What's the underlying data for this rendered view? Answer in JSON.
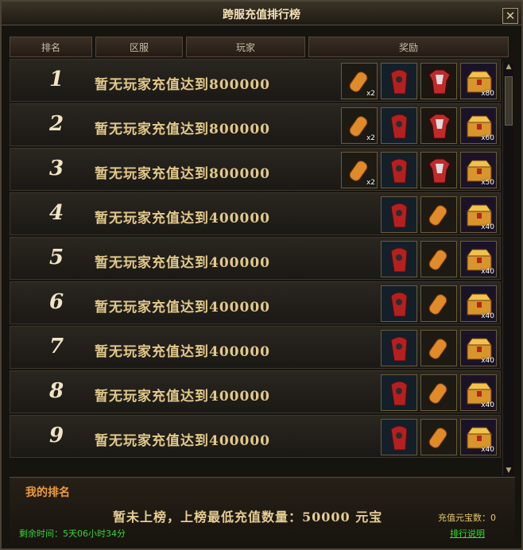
{
  "window": {
    "title": "跨服充值排行榜",
    "close_label": "✕"
  },
  "header": {
    "col_rank": "排名",
    "col_server": "区服",
    "col_player": "玩家",
    "col_reward": "奖励"
  },
  "rows": [
    {
      "rank": "1",
      "msg": "暂无玩家充值达到800000",
      "items": [
        {
          "icon": "orange-bullet-icon",
          "count": "x2",
          "q": "gold"
        },
        {
          "icon": "red-cloak-icon",
          "count": "",
          "q": "gold"
        },
        {
          "icon": "red-armor-icon",
          "count": "",
          "q": "gold"
        },
        {
          "icon": "treasure-chest-icon",
          "count": "x80",
          "q": "purple"
        }
      ]
    },
    {
      "rank": "2",
      "msg": "暂无玩家充值达到800000",
      "items": [
        {
          "icon": "orange-bullet-icon",
          "count": "x2",
          "q": "gold"
        },
        {
          "icon": "red-cloak-icon",
          "count": "",
          "q": "gold"
        },
        {
          "icon": "red-armor-icon",
          "count": "",
          "q": "gold"
        },
        {
          "icon": "treasure-chest-icon",
          "count": "x60",
          "q": "purple"
        }
      ]
    },
    {
      "rank": "3",
      "msg": "暂无玩家充值达到800000",
      "items": [
        {
          "icon": "orange-bullet-icon",
          "count": "x2",
          "q": "gold"
        },
        {
          "icon": "red-cloak-icon",
          "count": "",
          "q": "gold"
        },
        {
          "icon": "red-armor-icon",
          "count": "",
          "q": "gold"
        },
        {
          "icon": "treasure-chest-icon",
          "count": "x50",
          "q": "purple"
        }
      ]
    },
    {
      "rank": "4",
      "msg": "暂无玩家充值达到400000",
      "items": [
        {
          "icon": "red-cloak-icon",
          "count": "",
          "q": "gold"
        },
        {
          "icon": "orange-bullet-icon",
          "count": "",
          "q": "gold"
        },
        {
          "icon": "treasure-chest-icon",
          "count": "x40",
          "q": "purple"
        }
      ]
    },
    {
      "rank": "5",
      "msg": "暂无玩家充值达到400000",
      "items": [
        {
          "icon": "red-cloak-icon",
          "count": "",
          "q": "gold"
        },
        {
          "icon": "orange-bullet-icon",
          "count": "",
          "q": "gold"
        },
        {
          "icon": "treasure-chest-icon",
          "count": "x40",
          "q": "purple"
        }
      ]
    },
    {
      "rank": "6",
      "msg": "暂无玩家充值达到400000",
      "items": [
        {
          "icon": "red-cloak-icon",
          "count": "",
          "q": "gold"
        },
        {
          "icon": "orange-bullet-icon",
          "count": "",
          "q": "gold"
        },
        {
          "icon": "treasure-chest-icon",
          "count": "x40",
          "q": "purple"
        }
      ]
    },
    {
      "rank": "7",
      "msg": "暂无玩家充值达到400000",
      "items": [
        {
          "icon": "red-cloak-icon",
          "count": "",
          "q": "gold"
        },
        {
          "icon": "orange-bullet-icon",
          "count": "",
          "q": "gold"
        },
        {
          "icon": "treasure-chest-icon",
          "count": "x40",
          "q": "purple"
        }
      ]
    },
    {
      "rank": "8",
      "msg": "暂无玩家充值达到400000",
      "items": [
        {
          "icon": "red-cloak-icon",
          "count": "",
          "q": "gold"
        },
        {
          "icon": "orange-bullet-icon",
          "count": "",
          "q": "gold"
        },
        {
          "icon": "treasure-chest-icon",
          "count": "x40",
          "q": "purple"
        }
      ]
    },
    {
      "rank": "9",
      "msg": "暂无玩家充值达到400000",
      "items": [
        {
          "icon": "red-cloak-icon",
          "count": "",
          "q": "gold"
        },
        {
          "icon": "orange-bullet-icon",
          "count": "",
          "q": "gold"
        },
        {
          "icon": "treasure-chest-icon",
          "count": "x40",
          "q": "purple"
        }
      ]
    }
  ],
  "bottom": {
    "my_rank_label": "我的排名",
    "notice": "暂未上榜，上榜最低充值数量：50000 元宝",
    "recharge": "充值元宝数：0",
    "remaining": "剩余时间：5天06小时34分",
    "explain_link": "排行说明"
  },
  "colors": {
    "accent": "#f09a3c",
    "gold_text": "#e2c98a",
    "green": "#36d436"
  }
}
